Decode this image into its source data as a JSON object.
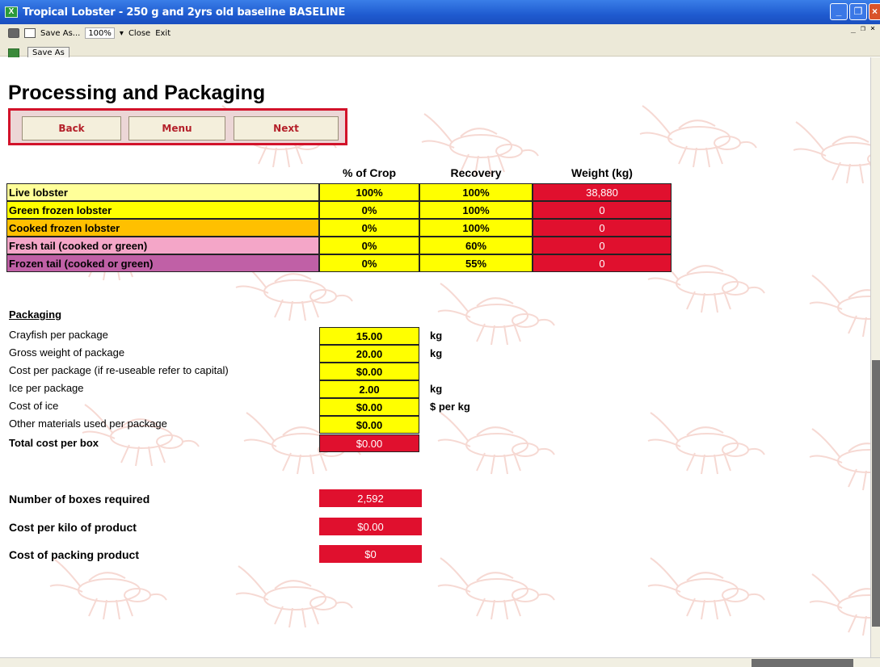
{
  "window": {
    "title": "Tropical Lobster - 250 g and 2yrs old baseline BASELINE"
  },
  "toolbar": {
    "save_as_label": "Save As...",
    "zoom": "100%",
    "close_label": "Close",
    "exit_label": "Exit",
    "save_as_button": "Save As"
  },
  "page": {
    "title": "Processing and Packaging"
  },
  "nav": {
    "back": "Back",
    "menu": "Menu",
    "next": "Next"
  },
  "table": {
    "headers": {
      "crop": "% of Crop",
      "recovery": "Recovery",
      "weight": "Weight (kg)"
    },
    "rows": [
      {
        "label": "Live lobster",
        "crop": "100%",
        "recovery": "100%",
        "weight": "38,880",
        "color": "#ffff99"
      },
      {
        "label": "Green frozen lobster",
        "crop": "0%",
        "recovery": "100%",
        "weight": "0",
        "color": "#ffff00"
      },
      {
        "label": "Cooked frozen lobster",
        "crop": "0%",
        "recovery": "100%",
        "weight": "0",
        "color": "#ffc000"
      },
      {
        "label": "Fresh tail (cooked or green)",
        "crop": "0%",
        "recovery": "60%",
        "weight": "0",
        "color": "#f4a6c8"
      },
      {
        "label": "Frozen tail (cooked or green)",
        "crop": "0%",
        "recovery": "55%",
        "weight": "0",
        "color": "#c060a6"
      }
    ]
  },
  "packaging": {
    "heading": "Packaging",
    "items": [
      {
        "label": "Crayfish per package",
        "value": "15.00",
        "unit": "kg"
      },
      {
        "label": "Gross weight of package",
        "value": "20.00",
        "unit": "kg"
      },
      {
        "label": "Cost per package (if re-useable refer to capital)",
        "value": "$0.00",
        "unit": ""
      },
      {
        "label": "Ice per package",
        "value": "2.00",
        "unit": "kg"
      },
      {
        "label": "Cost of ice",
        "value": "$0.00",
        "unit": "$ per kg"
      },
      {
        "label": "Other materials used per package",
        "value": "$0.00",
        "unit": ""
      }
    ],
    "total": {
      "label": "Total cost per box",
      "value": "$0.00"
    }
  },
  "summary": [
    {
      "label": "Number of boxes required",
      "value": "2,592"
    },
    {
      "label": "Cost per kilo of product",
      "value": "$0.00"
    },
    {
      "label": "Cost of packing product",
      "value": "$0"
    }
  ]
}
